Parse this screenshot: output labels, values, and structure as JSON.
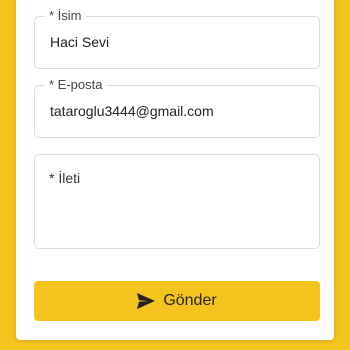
{
  "form": {
    "name_label": "* İsim",
    "name_value": "Haci Sevi",
    "email_label": "* E-posta",
    "email_value": "tataroglu3444@gmail.com",
    "message_placeholder": "* İleti",
    "send_label": "Gönder",
    "send_icon": "paper-plane-icon"
  },
  "colors": {
    "accent": "#f5c41f",
    "card": "#ffffff",
    "border": "#dcdcdc"
  }
}
